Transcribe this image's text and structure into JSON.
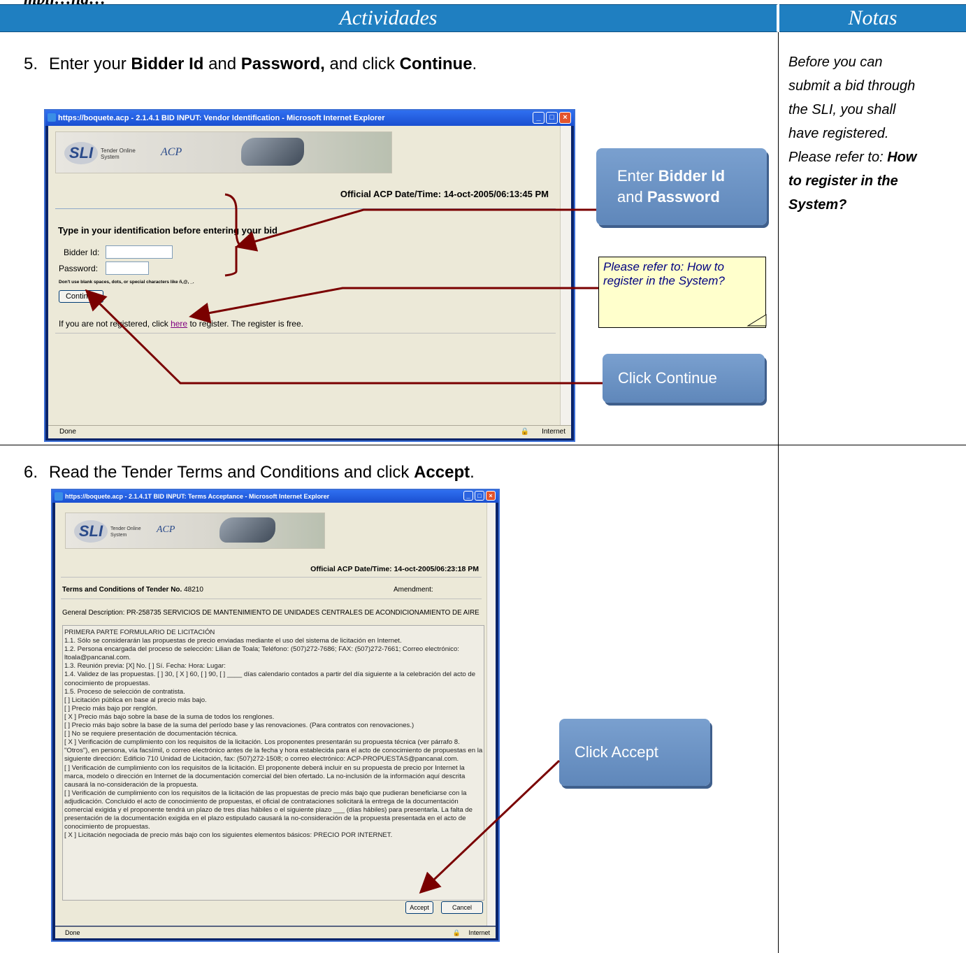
{
  "header": {
    "fragment": "mplj…ng…",
    "activities": "Actividades",
    "notes": "Notas"
  },
  "step5": {
    "number": "5.",
    "pre": "Enter your ",
    "b1": "Bidder Id",
    "mid": " and ",
    "b2": "Password,",
    "mid2": " and click ",
    "b3": "Continue",
    "end": "."
  },
  "step6": {
    "number": "6.",
    "pre": "Read the Tender Terms and Conditions  and click ",
    "b1": "Accept",
    "end": "."
  },
  "notes": {
    "line1": "Before you can",
    "line2": "submit a bid  through",
    "line3": "the SLI, you shall",
    "line4": "have registered.",
    "line5_pre": "Please refer to: ",
    "line5_bold": "How",
    "line6": "to register in the",
    "line7": "System?"
  },
  "window1": {
    "title": "https://boquete.acp - 2.1.4.1 BID INPUT: Vendor Identification - Microsoft Internet Explorer",
    "logo": "SLI",
    "logo_sub": "Tender Online System",
    "acp": "ACP",
    "datetime": "Official ACP Date/Time: 14-oct-2005/06:13:45 PM",
    "heading": "Type in your identification before entering your bid",
    "bidder_label": "Bidder Id:",
    "password_label": "Password:",
    "hint": "Don't use blank spaces, dots, or special characters like ñ,@, _.",
    "continue": "Continue",
    "reg_pre": "If you are not registered, click ",
    "reg_link": "here",
    "reg_post": " to register. The register is free.",
    "status_done": "Done",
    "status_zone": "Internet"
  },
  "callouts": {
    "enter_pre": "Enter ",
    "enter_b1": "Bidder Id",
    "enter_and": "and ",
    "enter_b2": "Password",
    "note": "Please refer to: How to register in the System?",
    "click_continue": "Click   Continue",
    "click_accept": "Click  Accept"
  },
  "window2": {
    "title": "https://boquete.acp - 2.1.4.1T BID INPUT: Terms Acceptance - Microsoft Internet Explorer",
    "logo": "SLI",
    "logo_sub": "Tender Online System",
    "acp": "ACP",
    "datetime": "Official ACP Date/Time: 14-oct-2005/06:23:18 PM",
    "terms_title": "Terms and Conditions of Tender No.",
    "tender_no": "48210",
    "amendment": "Amendment:",
    "general": "General Description: PR-258735 SERVICIOS DE MANTENIMIENTO DE UNIDADES CENTRALES DE ACONDICIONAMIENTO DE AIRE",
    "lines": [
      "PRIMERA PARTE FORMULARIO DE LICITACIÓN",
      "1.1. Sólo se considerarán las propuestas de precio enviadas mediante el uso del sistema de licitación en Internet.",
      "1.2. Persona encargada del proceso de selección: Lilian de Toala; Teléfono: (507)272-7686; FAX: (507)272-7661; Correo electrónico:",
      "ltoala@pancanal.com.",
      "1.3. Reunión previa: [X] No. [ ] Sí. Fecha: Hora: Lugar:",
      "1.4. Validez de las propuestas. [ ] 30, [ X ] 60, [ ] 90, [ ] ____ días calendario contados a partir del día siguiente a la celebración del acto de",
      "conocimiento de propuestas.",
      "1.5. Proceso de selección de contratista.",
      "[ ] Licitación pública en base al precio más bajo.",
      "[ ] Precio más bajo por renglón.",
      "[ X ] Precio más bajo sobre la base de la suma de todos los renglones.",
      "[ ] Precio más bajo sobre la base de la suma del período base y las renovaciones. (Para contratos con renovaciones.)",
      "[ ] No se requiere presentación de documentación técnica.",
      "[ X ] Verificación de cumplimiento con los requisitos de la licitación. Los proponentes presentarán su propuesta técnica (ver párrafo 8.",
      "\"Otros\"), en persona, vía facsímil, o correo electrónico antes de la fecha y hora establecida para el acto de conocimiento de propuestas en la",
      "siguiente dirección: Edificio 710 Unidad de Licitación, fax: (507)272-1508; o correo electrónico: ACP-PROPUESTAS@pancanal.com.",
      "[ ] Verificación de cumplimiento con los requisitos de la licitación. El proponente deberá incluir en su propuesta de precio por Internet la",
      "marca, modelo o dirección en Internet de la documentación comercial del bien ofertado. La no-inclusión de la información aquí descrita",
      "causará la no-consideración de la propuesta.",
      "[ ] Verificación de cumplimiento con los requisitos de la licitación de las propuestas de precio más bajo que pudieran beneficiarse con la",
      "adjudicación. Concluido el acto de conocimiento de propuestas, el oficial de contrataciones solicitará la entrega de la documentación",
      "comercial exigida y el proponente tendrá un plazo de tres días hábiles o el siguiente plazo ___ (días hábiles) para presentarla. La falta de",
      "presentación de la documentación exigida en el plazo estipulado causará la no-consideración de la propuesta presentada en el acto de",
      "conocimiento de propuestas.",
      "[ X ] Licitación negociada de precio más bajo con los siguientes elementos básicos: PRECIO POR INTERNET."
    ],
    "accept": "Accept",
    "cancel": "Cancel",
    "status_done": "Done",
    "status_zone": "Internet"
  }
}
